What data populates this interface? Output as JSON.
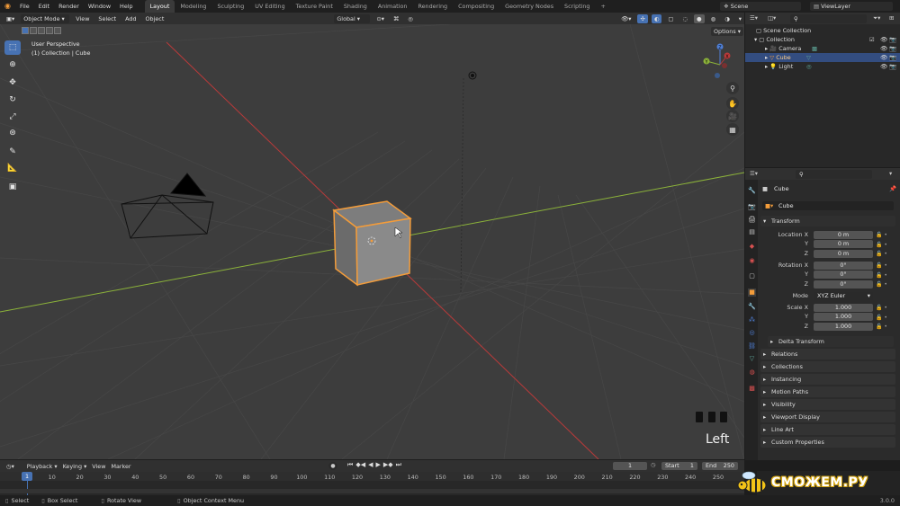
{
  "topbar": {
    "menus": [
      "File",
      "Edit",
      "Render",
      "Window",
      "Help"
    ],
    "workspaces": [
      "Layout",
      "Modeling",
      "Sculpting",
      "UV Editing",
      "Texture Paint",
      "Shading",
      "Animation",
      "Rendering",
      "Compositing",
      "Geometry Nodes",
      "Scripting"
    ],
    "active_workspace": "Layout",
    "add_tab": "+",
    "scene_label": "Scene",
    "viewlayer_label": "ViewLayer"
  },
  "viewport_header": {
    "mode": "Object Mode",
    "menus": [
      "View",
      "Select",
      "Add",
      "Object"
    ],
    "orientation": "Global",
    "options": "Options"
  },
  "viewport": {
    "perspective": "User Perspective",
    "collection_info": "(1) Collection | Cube",
    "view_name": "Left",
    "gizmo_axes": [
      "X",
      "Y",
      "Z"
    ]
  },
  "outliner": {
    "scene_collection": "Scene Collection",
    "items": [
      {
        "label": "Collection"
      },
      {
        "label": "Camera"
      },
      {
        "label": "Cube",
        "selected": true
      },
      {
        "label": "Light"
      }
    ]
  },
  "properties": {
    "object_name": "Cube",
    "datablock": "Cube",
    "transform_title": "Transform",
    "location": {
      "label": "Location X",
      "x": "0 m",
      "y": "0 m",
      "z": "0 m"
    },
    "rotation": {
      "label": "Rotation X",
      "x": "0°",
      "y": "0°",
      "z": "0°"
    },
    "mode_label": "Mode",
    "mode_value": "XYZ Euler",
    "scale": {
      "label": "Scale X",
      "x": "1.000",
      "y": "1.000",
      "z": "1.000"
    },
    "y_label": "Y",
    "z_label": "Z",
    "delta_transform": "Delta Transform",
    "panels": [
      "Relations",
      "Collections",
      "Instancing",
      "Motion Paths",
      "Visibility",
      "Viewport Display",
      "Line Art",
      "Custom Properties"
    ]
  },
  "timeline": {
    "menus": [
      "Playback",
      "Keying",
      "View",
      "Marker"
    ],
    "current_frame": "1",
    "start_label": "Start",
    "start_value": "1",
    "end_label": "End",
    "end_value": "250",
    "frame_numbers": [
      "1",
      "10",
      "20",
      "30",
      "40",
      "50",
      "60",
      "70",
      "80",
      "90",
      "100",
      "110",
      "120",
      "130",
      "140",
      "150",
      "160",
      "170",
      "180",
      "190",
      "200",
      "210",
      "220",
      "230",
      "240",
      "250"
    ]
  },
  "statusbar": {
    "select": "Select",
    "box_select": "Box Select",
    "rotate_view": "Rotate View",
    "context_menu": "Object Context Menu",
    "version": "3.0.0"
  },
  "watermark": "СМОЖЕМ.РУ",
  "colors": {
    "accent": "#4772b3",
    "selection": "#334d80",
    "x_axis": "#ba3a3a",
    "y_axis": "#8cb33a",
    "cube_outline": "#f39c3a",
    "viewport_bg": "#3d3d3d"
  }
}
